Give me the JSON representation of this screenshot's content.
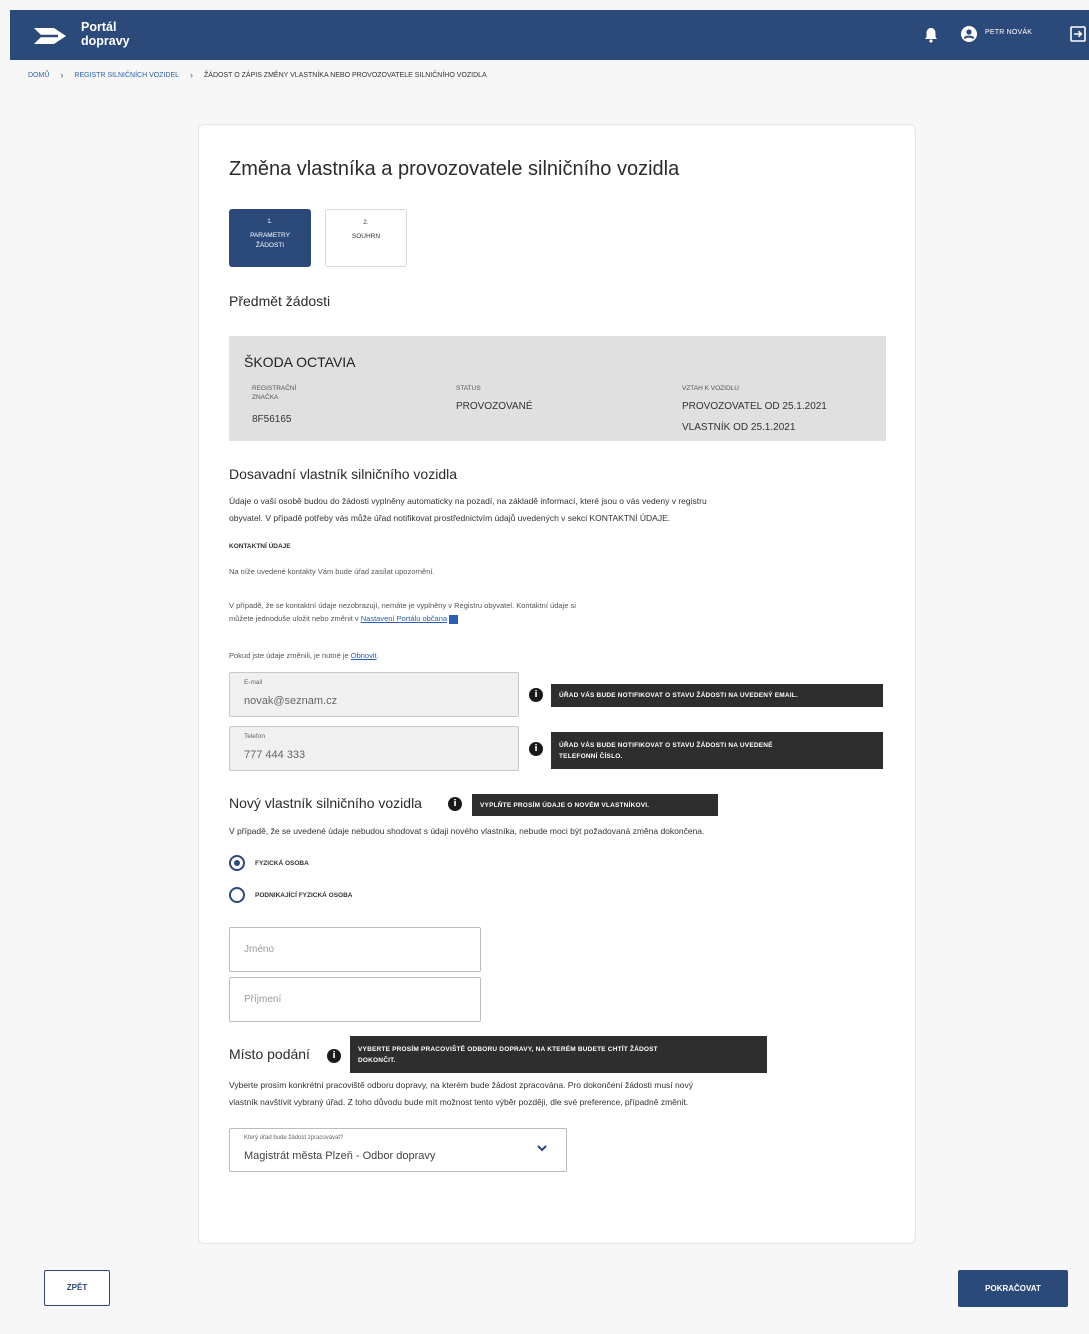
{
  "header": {
    "brand_line1": "Portál",
    "brand_line2": "dopravy",
    "user_name": "PETR NOVÁK",
    "color": "#2b4a7a"
  },
  "breadcrumb": {
    "home": "DOMŮ",
    "registry": "REGISTR SILNIČNÍCH VOZIDEL",
    "current": "ŽÁDOST O ZÁPIS ZMĚNY VLASTNÍKA NEBO PROVOZOVATELE SILNIČNÍHO VOZIDLA"
  },
  "page": {
    "title": "Změna vlastníka a provozovatele silničního vozidla"
  },
  "steps": [
    {
      "number": "1.",
      "label_line1": "PARAMETRY",
      "label_line2": "ŽÁDOSTI",
      "active": true
    },
    {
      "number": "2.",
      "label_line1": "SOUHRN",
      "label_line2": "",
      "active": false
    }
  ],
  "subject": {
    "heading": "Předmět žádosti",
    "vehicle_name": "ŠKODA OCTAVIA",
    "reg_label_line1": "REGISTRAČNÍ",
    "reg_label_line2": "ZNAČKA",
    "reg_value": "8F56165",
    "status_label": "STATUS",
    "status_value": "PROVOZOVANÉ",
    "relation_label": "VZTAH K VOZIDLU",
    "relation_value_1": "PROVOZOVATEL OD 25.1.2021",
    "relation_value_2": "VLASTNÍK OD 25.1.2021"
  },
  "previous_owner": {
    "heading": "Dosavadní vlastník silničního vozidla",
    "para_line1": "Údaje o vaší osobě budou do žádosti vyplněny automaticky na pozadí, na základě informací, které jsou o vás vedeny v registru",
    "para_line2": "obyvatel. V případě potřeby vás může úřad notifikovat prostřednictvím údajů uvedených v sekci KONTAKTNÍ ÚDAJE.",
    "contact_heading": "KONTAKTNÍ ÚDAJE",
    "contact_note": "Na níže uvedené kontakty Vám bude úřad zasílat upozornění.",
    "contact_info_line1": "V případě, že se kontaktní údaje nezobrazují, nemáte je vyplněny v Registru obyvatel. Kontaktní údaje si",
    "contact_info_line2_prefix": "můžete jednoduše uložit nebo změnit v",
    "contact_info_link": "Nastavení Portálu občana",
    "refresh_prefix": "Pokud jste údaje změnili, je nutné je",
    "refresh_link": "Obnovit",
    "email_label": "E-mail",
    "email_value": "novak@seznam.cz",
    "email_tooltip": "ÚŘAD VÁS BUDE NOTIFIKOVAT O STAVU ŽÁDOSTI NA UVEDENÝ EMAIL.",
    "phone_label": "Telefon",
    "phone_value": "777 444 333",
    "phone_tooltip_line1": "ÚŘAD VÁS BUDE NOTIFIKOVAT O STAVU ŽÁDOSTI NA UVEDENÉ",
    "phone_tooltip_line2": "TELEFONNÍ ČÍSLO."
  },
  "new_owner": {
    "heading": "Nový vlastník silničního vozidla",
    "tooltip": "VYPLŇTE PROSÍM ÚDAJE O NOVÉM VLASTNÍKOVI.",
    "note": "V případě, že se uvedené údaje nebudou shodovat s údaji nového vlastníka, nebude moci být požadovaná změna dokončena.",
    "radio_1": "FYZICKÁ OSOBA",
    "radio_2": "PODNIKAJÍCÍ FYZICKÁ OSOBA",
    "first_name_placeholder": "Jméno",
    "last_name_placeholder": "Příjmení"
  },
  "place": {
    "heading": "Místo podání",
    "tooltip_line1": "VYBERTE PROSÍM PRACOVIŠTĚ ODBORU DOPRAVY, NA KTERÉM BUDETE CHTÍT ŽÁDOST",
    "tooltip_line2": "DOKONČIT.",
    "para_line1": "Vyberte prosím konkrétní pracoviště odboru dopravy, na kterém bude žádost zpracována. Pro dokončení žádosti musí nový",
    "para_line2": "vlastník navštívit vybraný úřad. Z toho důvodu bude mít možnost tento výběr později, dle své preference, případně změnit.",
    "select_label": "Který úřad bude žádost zpracovávat?",
    "select_value": "Magistrát města Plzeň - Odbor dopravy"
  },
  "footer": {
    "back_label": "ZPĚT",
    "next_label": "POKRAČOVAT"
  }
}
